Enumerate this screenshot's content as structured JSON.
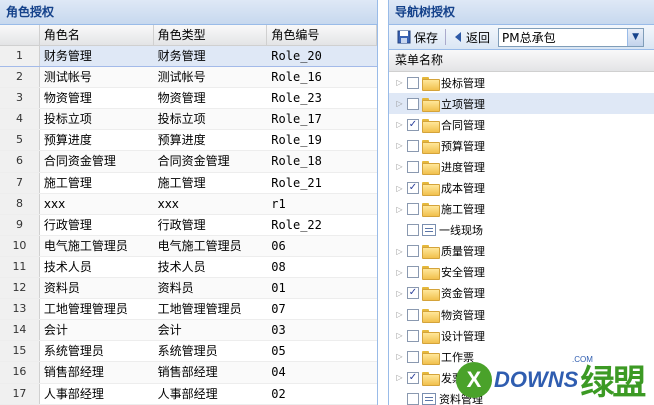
{
  "left": {
    "title": "角色授权",
    "columns": [
      "",
      "角色名",
      "角色类型",
      "角色编号"
    ],
    "rows": [
      {
        "n": "1",
        "name": "财务管理",
        "type": "财务管理",
        "code": "Role_20"
      },
      {
        "n": "2",
        "name": "测试帐号",
        "type": "测试帐号",
        "code": "Role_16"
      },
      {
        "n": "3",
        "name": "物资管理",
        "type": "物资管理",
        "code": "Role_23"
      },
      {
        "n": "4",
        "name": "投标立项",
        "type": "投标立项",
        "code": "Role_17"
      },
      {
        "n": "5",
        "name": "预算进度",
        "type": "预算进度",
        "code": "Role_19"
      },
      {
        "n": "6",
        "name": "合同资金管理",
        "type": "合同资金管理",
        "code": "Role_18"
      },
      {
        "n": "7",
        "name": "施工管理",
        "type": "施工管理",
        "code": "Role_21"
      },
      {
        "n": "8",
        "name": "xxx",
        "type": "xxx",
        "code": "r1"
      },
      {
        "n": "9",
        "name": "行政管理",
        "type": "行政管理",
        "code": "Role_22"
      },
      {
        "n": "10",
        "name": "电气施工管理员",
        "type": "电气施工管理员",
        "code": "06"
      },
      {
        "n": "11",
        "name": "技术人员",
        "type": "技术人员",
        "code": "08"
      },
      {
        "n": "12",
        "name": "资料员",
        "type": "资料员",
        "code": "01"
      },
      {
        "n": "13",
        "name": "工地管理管理员",
        "type": "工地管理管理员",
        "code": "07"
      },
      {
        "n": "14",
        "name": "会计",
        "type": "会计",
        "code": "03"
      },
      {
        "n": "15",
        "name": "系统管理员",
        "type": "系统管理员",
        "code": "05"
      },
      {
        "n": "16",
        "name": "销售部经理",
        "type": "销售部经理",
        "code": "04"
      },
      {
        "n": "17",
        "name": "人事部经理",
        "type": "人事部经理",
        "code": "02"
      }
    ]
  },
  "right": {
    "title": "导航树授权",
    "save_label": "保存",
    "back_label": "返回",
    "select_value": "PM总承包",
    "tree_header": "菜单名称",
    "items": [
      {
        "label": "投标管理",
        "checked": false,
        "kind": "folder",
        "expander": "▷"
      },
      {
        "label": "立项管理",
        "checked": false,
        "kind": "folder",
        "expander": "▷"
      },
      {
        "label": "合同管理",
        "checked": true,
        "kind": "folder",
        "expander": "▷"
      },
      {
        "label": "预算管理",
        "checked": false,
        "kind": "folder",
        "expander": "▷"
      },
      {
        "label": "进度管理",
        "checked": false,
        "kind": "folder",
        "expander": "▷"
      },
      {
        "label": "成本管理",
        "checked": true,
        "kind": "folder",
        "expander": "▷"
      },
      {
        "label": "施工管理",
        "checked": false,
        "kind": "folder",
        "expander": "▷"
      },
      {
        "label": "一线现场",
        "checked": false,
        "kind": "leaf",
        "expander": ""
      },
      {
        "label": "质量管理",
        "checked": false,
        "kind": "folder",
        "expander": "▷"
      },
      {
        "label": "安全管理",
        "checked": false,
        "kind": "folder",
        "expander": "▷"
      },
      {
        "label": "资金管理",
        "checked": true,
        "kind": "folder",
        "expander": "▷"
      },
      {
        "label": "物资管理",
        "checked": false,
        "kind": "folder",
        "expander": "▷"
      },
      {
        "label": "设计管理",
        "checked": false,
        "kind": "folder",
        "expander": "▷"
      },
      {
        "label": "工作票",
        "checked": false,
        "kind": "folder",
        "expander": "▷"
      },
      {
        "label": "发票",
        "checked": true,
        "kind": "folder",
        "expander": "▷"
      },
      {
        "label": "资料管理",
        "checked": false,
        "kind": "leaf",
        "expander": ""
      }
    ]
  },
  "watermark": {
    "x": "X",
    "text": "DOWNS",
    "com": ".COM",
    "cn": "绿盟"
  },
  "colors": {
    "header_text": "#15428b",
    "border": "#99bbe8",
    "selected": "#dfe8f6",
    "watermark_green": "#3c9a24",
    "watermark_blue": "#2f5db0"
  }
}
